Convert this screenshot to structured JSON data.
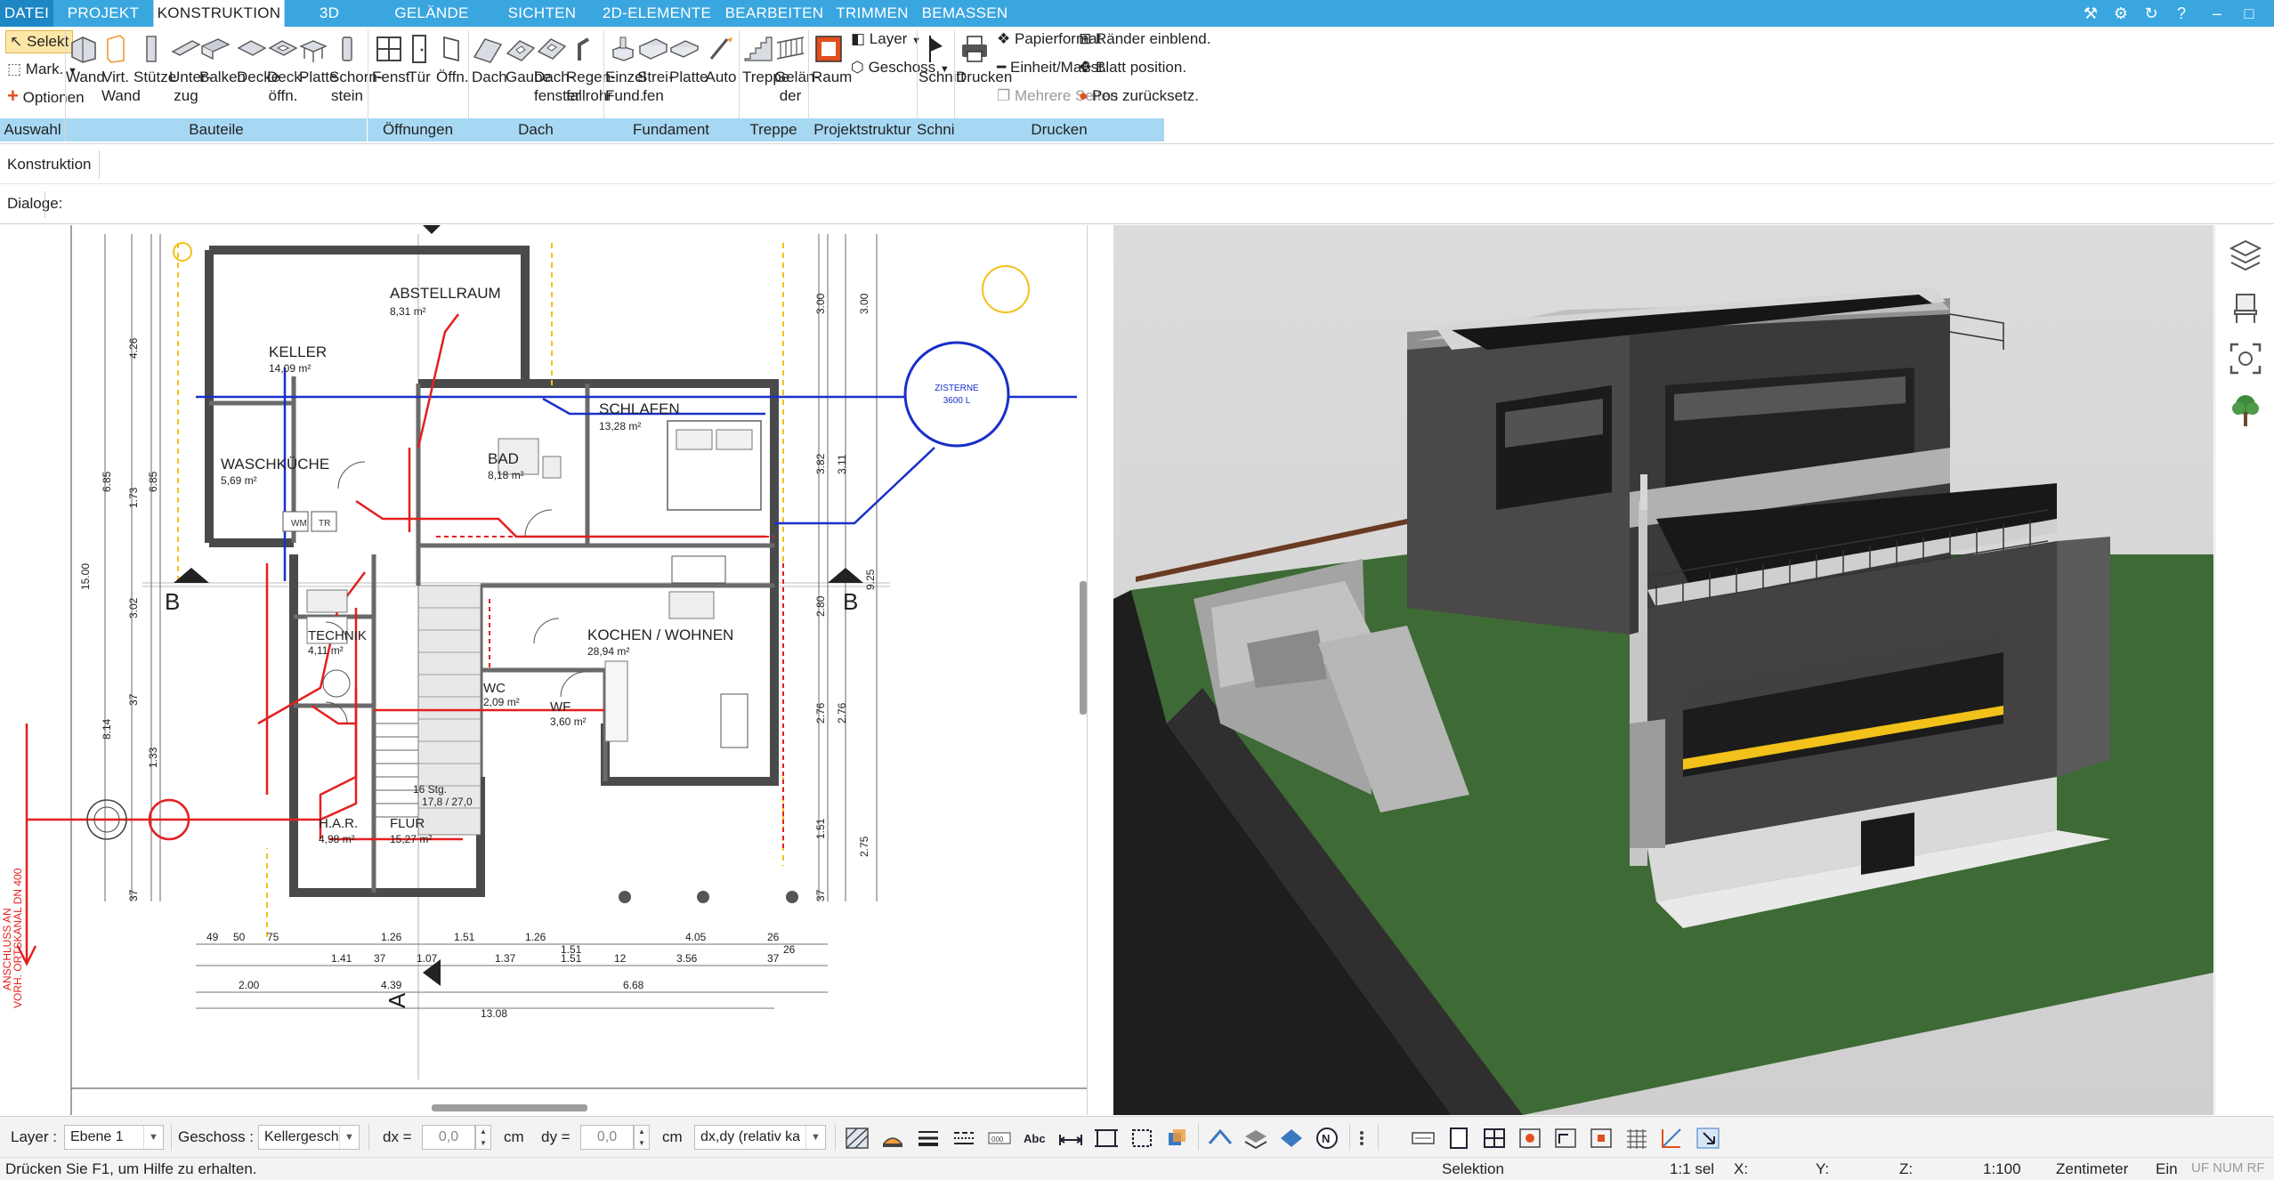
{
  "tabs": [
    "DATEI",
    "PROJEKT",
    "KONSTRUKTION",
    "3D",
    "GELÄNDE",
    "SICHTEN",
    "2D-ELEMENTE",
    "BEARBEITEN",
    "TRIMMEN",
    "BEMASSEN"
  ],
  "ribbon": {
    "auswahl": {
      "selekt": "Selekt",
      "mark": "Mark.",
      "optionen": "Optionen",
      "group": "Auswahl"
    },
    "bauteile": {
      "group": "Bauteile",
      "buttons": [
        {
          "l1": "Wand",
          "l2": ""
        },
        {
          "l1": "Virt.",
          "l2": "Wand"
        },
        {
          "l1": "Stütze",
          "l2": ""
        },
        {
          "l1": "Unter-",
          "l2": "zug"
        },
        {
          "l1": "Balken",
          "l2": ""
        },
        {
          "l1": "Decke",
          "l2": ""
        },
        {
          "l1": "Deck-",
          "l2": "öffn."
        },
        {
          "l1": "Platte",
          "l2": ""
        },
        {
          "l1": "Schorn-",
          "l2": "stein"
        }
      ]
    },
    "oeffnungen": {
      "group": "Öffnungen",
      "buttons": [
        {
          "l1": "Fenst"
        },
        {
          "l1": "Tür"
        },
        {
          "l1": "Öffn."
        }
      ]
    },
    "dach": {
      "group": "Dach",
      "buttons": [
        {
          "l1": "Dach",
          "l2": ""
        },
        {
          "l1": "Gaube",
          "l2": ""
        },
        {
          "l1": "Dach-",
          "l2": "fenster"
        },
        {
          "l1": "Regen-",
          "l2": "fallrohr"
        }
      ]
    },
    "fundament": {
      "group": "Fundament",
      "buttons": [
        {
          "l1": "Einzel",
          "l2": "Fund."
        },
        {
          "l1": "Strei-",
          "l2": "fen"
        },
        {
          "l1": "Platte",
          "l2": ""
        },
        {
          "l1": "Auto",
          "l2": ""
        }
      ]
    },
    "treppe": {
      "group": "Treppe",
      "buttons": [
        {
          "l1": "Treppe",
          "l2": ""
        },
        {
          "l1": "Gelän-",
          "l2": "der"
        }
      ]
    },
    "projektstruktur": {
      "group": "Projektstruktur",
      "raum": "Raum",
      "layer": "Layer",
      "geschoss": "Geschoss"
    },
    "schnitt": {
      "group": "Schnitt",
      "label": "Schnitt"
    },
    "drucken": {
      "group": "Drucken",
      "drucken": "Drucken",
      "papierformat": "Papierformat",
      "einheit": "Einheit/Maßst.",
      "mehrere": "Mehrere Seiten",
      "raender": "Ränder einblend.",
      "blatt": "Blatt position.",
      "pos": "Pos zurücksetz."
    }
  },
  "toolbar": {
    "konstruktion": "Konstruktion",
    "dialoge": "Dialoge:"
  },
  "plan": {
    "rooms": [
      {
        "name": "ABSTELLRAUM",
        "area": "8,31 m²"
      },
      {
        "name": "KELLER",
        "area": "14,09 m²"
      },
      {
        "name": "SCHLAFEN",
        "area": "13,28 m²"
      },
      {
        "name": "BAD",
        "area": "8,18 m²"
      },
      {
        "name": "WASCHKÜCHE",
        "area": "5,69 m²"
      },
      {
        "name": "KOCHEN / WOHNEN",
        "area": "28,94 m²"
      },
      {
        "name": "TECHNIK",
        "area": "4,11 m²"
      },
      {
        "name": "WC",
        "area": "2,09 m²"
      },
      {
        "name": "WF",
        "area": "3,60 m²"
      },
      {
        "name": "H.A.R.",
        "area": "4,98 m²"
      },
      {
        "name": "FLUR",
        "area": "15,27 m²"
      }
    ],
    "stairs": {
      "l1": "16 Stg.",
      "l2": "17,8 / 27,0"
    },
    "cistern": {
      "l1": "ZISTERNE",
      "l2": "3600 L"
    },
    "section_labels": [
      "B",
      "B",
      "A"
    ],
    "side_text": [
      "ANSCHLUSS AN",
      "VORH. ORTSKANAL DN 400"
    ],
    "appliances": [
      "WM",
      "TR"
    ],
    "dims_bottom_1": [
      "49",
      "50",
      "75",
      "1.26",
      "1.51",
      "1.26",
      "4.05",
      "26",
      "1.51",
      "26"
    ],
    "dims_bottom_2": [
      "1.41",
      "37",
      "1.07",
      "1.37",
      "1.51",
      "12",
      "3.56",
      "37"
    ],
    "dims_bottom_3": [
      "2.00",
      "4.39",
      "6.68",
      "13.08"
    ],
    "dims_left": [
      "6.85",
      "6.85",
      "15.00",
      "4.26",
      "1.73",
      "3.02",
      "8.14",
      "1.33",
      "37",
      "37"
    ],
    "dims_right": [
      "3.00",
      "3.00",
      "3.82",
      "3.11",
      "9.25",
      "2.80",
      "2.76",
      "2.76",
      "1.51",
      "2.75",
      "37"
    ]
  },
  "bottombar": {
    "layer_label": "Layer :",
    "layer_value": "Ebene 1",
    "geschoss_label": "Geschoss :",
    "geschoss_value": "Kellergesch",
    "dx_label": "dx =",
    "dx_value": "0,0",
    "dy_label": "dy =",
    "dy_value": "0,0",
    "unit": "cm",
    "mode": "dx,dy (relativ ka"
  },
  "status": {
    "help": "Drücken Sie F1, um Hilfe zu erhalten.",
    "selektion": "Selektion",
    "sel": "1:1 sel",
    "x": "X:",
    "y": "Y:",
    "z": "Z:",
    "scale": "1:100",
    "unit": "Zentimeter",
    "ein": "Ein",
    "flags": "UF NUM RF"
  },
  "colors": {
    "tab_blue": "#3aa6e0",
    "group_blue": "#a7d8f3",
    "plan_red": "#e41f1f",
    "plan_blue": "#1830c8",
    "plan_yellow": "#f2c11a",
    "grass": "#3e6a35",
    "wall": "#3b3939"
  }
}
